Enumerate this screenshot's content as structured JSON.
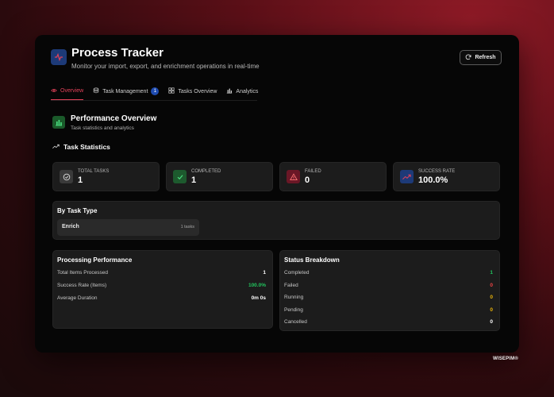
{
  "header": {
    "title": "Process Tracker",
    "subtitle": "Monitor your import, export, and enrichment operations in real-time",
    "refresh_label": "Refresh"
  },
  "tabs": [
    {
      "label": "Overview",
      "icon": "eye-icon",
      "active": true
    },
    {
      "label": "Task Management",
      "icon": "database-icon",
      "badge": "1"
    },
    {
      "label": "Tasks Overview",
      "icon": "grid-icon"
    },
    {
      "label": "Analytics",
      "icon": "bar-chart-icon"
    }
  ],
  "section": {
    "title": "Performance Overview",
    "subtitle": "Task statistics and analytics"
  },
  "stats_heading": "Task Statistics",
  "stats": [
    {
      "label": "TOTAL TASKS",
      "value": "1",
      "icon": "clock-icon",
      "color": "#3a3a3a"
    },
    {
      "label": "COMPLETED",
      "value": "1",
      "icon": "check-icon",
      "color": "#1d5a2e"
    },
    {
      "label": "FAILED",
      "value": "0",
      "icon": "warning-icon",
      "color": "#6a1726"
    },
    {
      "label": "SUCCESS RATE",
      "value": "100.0%",
      "icon": "trending-up-icon",
      "color": "#1d3a78"
    }
  ],
  "by_task_type": {
    "title": "By Task Type",
    "items": [
      {
        "name": "Enrich",
        "count": "1 tasks"
      }
    ]
  },
  "processing": {
    "title": "Processing Performance",
    "rows": [
      {
        "label": "Total Items Processed",
        "value": "1",
        "color": "#ffffff"
      },
      {
        "label": "Success Rate (Items)",
        "value": "100.0%",
        "color": "#22c55e"
      },
      {
        "label": "Average Duration",
        "value": "0m 0s",
        "color": "#ffffff"
      }
    ]
  },
  "status": {
    "title": "Status Breakdown",
    "rows": [
      {
        "label": "Completed",
        "value": "1",
        "color": "#22c55e"
      },
      {
        "label": "Failed",
        "value": "0",
        "color": "#ef4444"
      },
      {
        "label": "Running",
        "value": "0",
        "color": "#eab308"
      },
      {
        "label": "Pending",
        "value": "0",
        "color": "#eab308"
      },
      {
        "label": "Cancelled",
        "value": "0",
        "color": "#ffffff"
      }
    ]
  },
  "brand": "WISEPIM®"
}
